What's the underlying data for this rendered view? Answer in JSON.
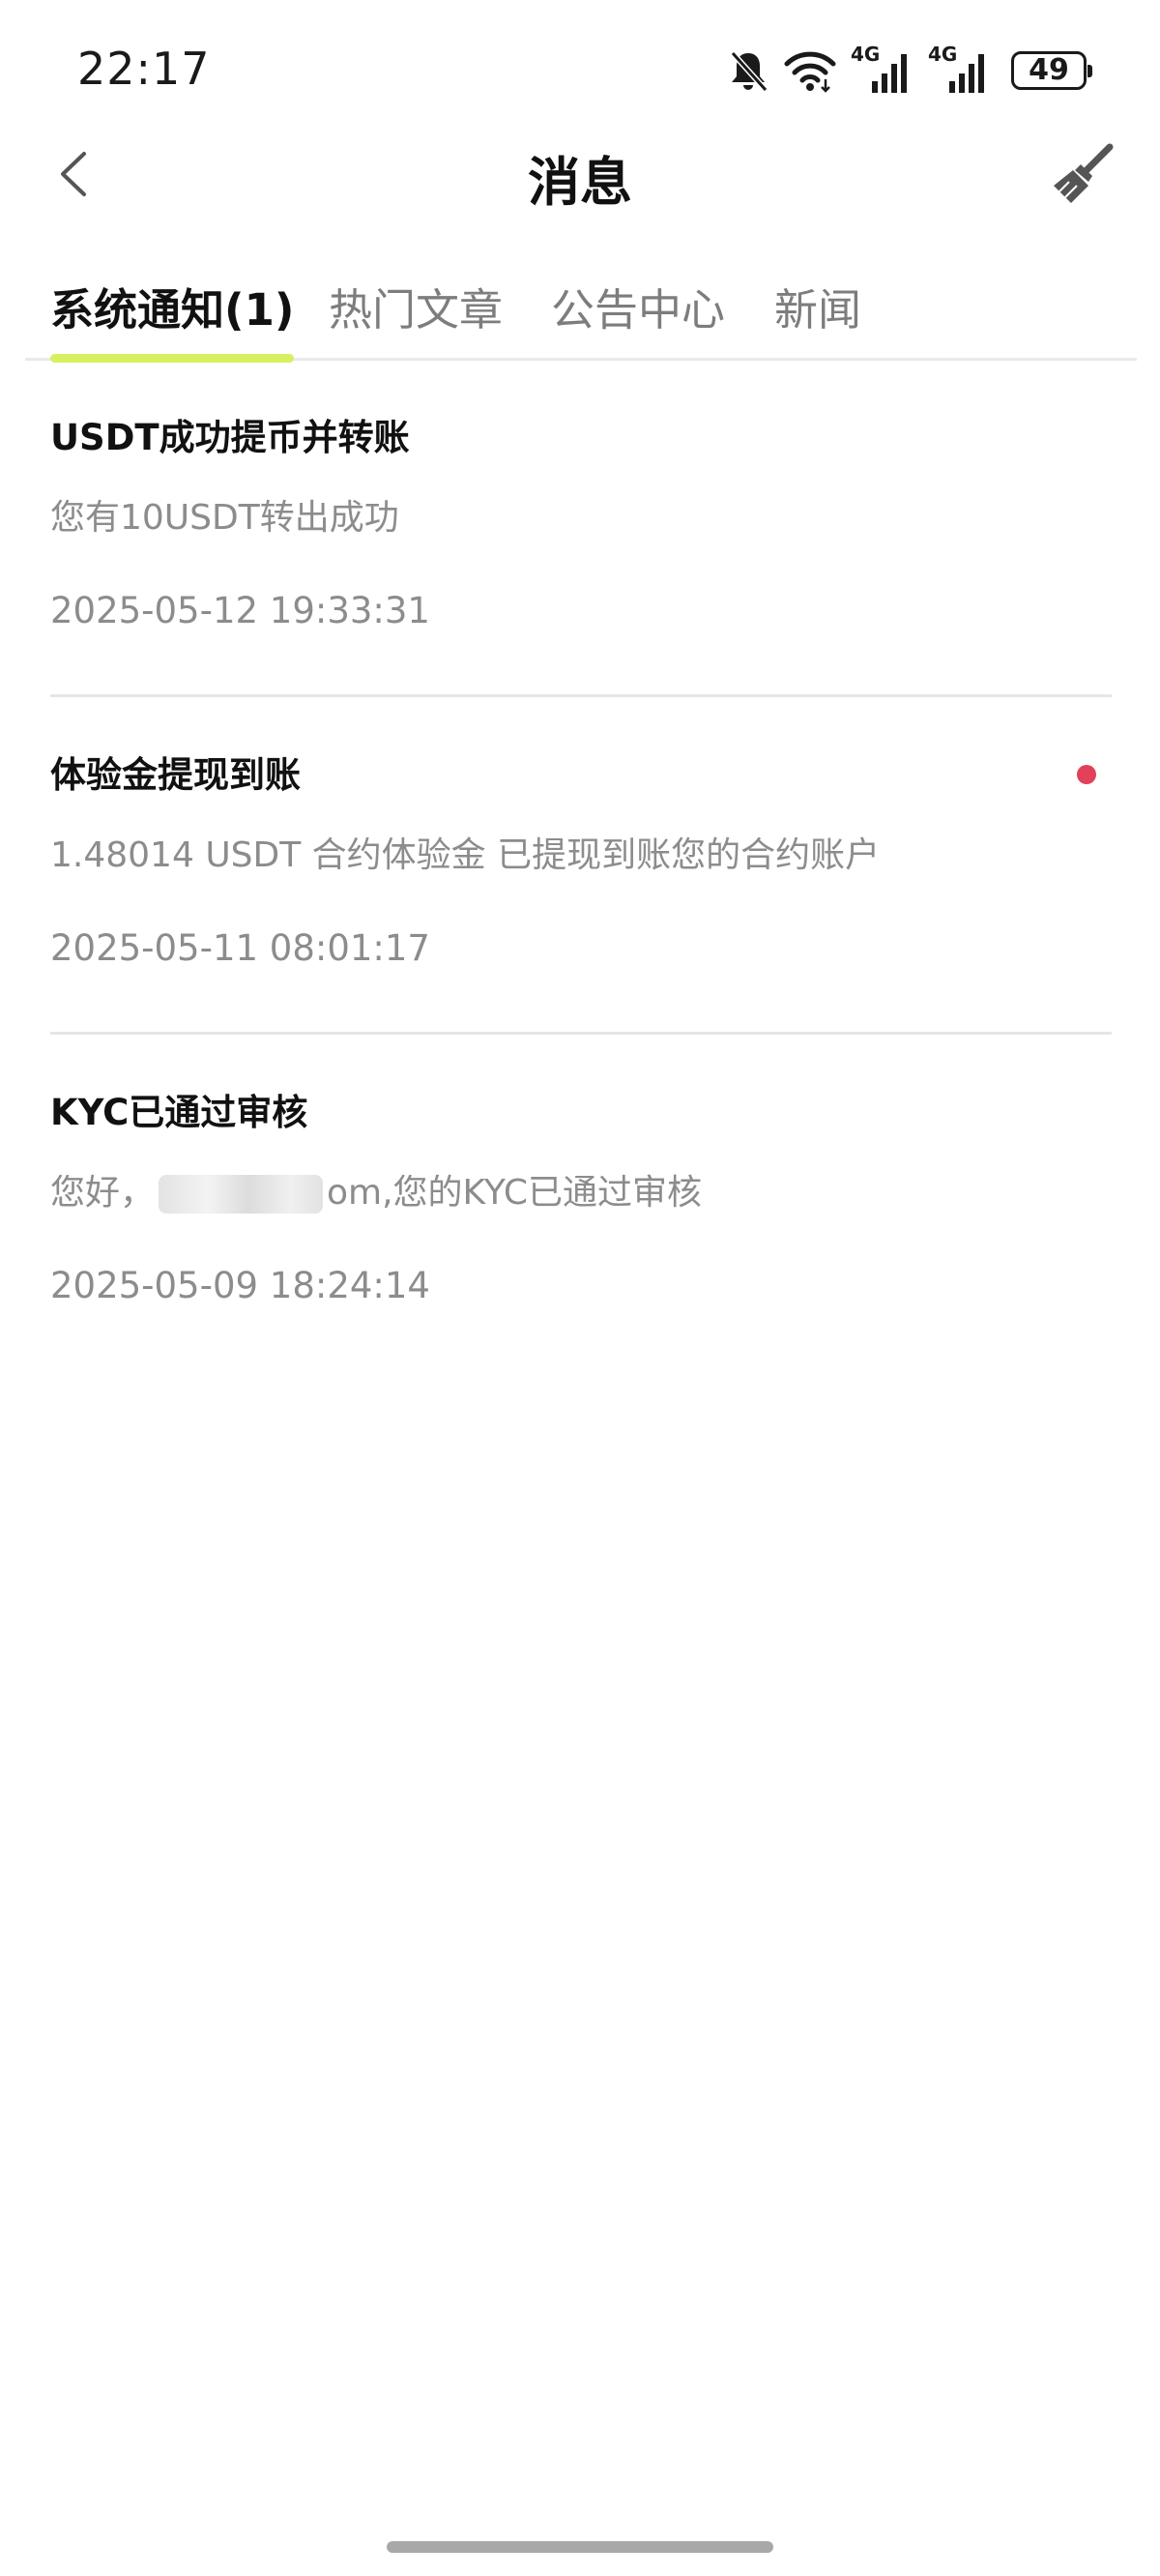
{
  "status_bar": {
    "time": "22:17",
    "network_1": "4G",
    "network_2": "4G",
    "battery": "49",
    "icons": [
      "bell-off-icon",
      "wifi-icon",
      "signal-icon",
      "signal-icon",
      "battery-icon"
    ]
  },
  "header": {
    "title": "消息",
    "back_icon": "chevron-left-icon",
    "clear_icon": "broom-icon"
  },
  "tabs": [
    {
      "label": "系统通知(1)",
      "active": true
    },
    {
      "label": "热门文章",
      "active": false
    },
    {
      "label": "公告中心",
      "active": false
    },
    {
      "label": "新闻",
      "active": false
    }
  ],
  "messages": [
    {
      "title": "USDT成功提币并转账",
      "body": "您有10USDT转出成功",
      "time": "2025-05-12 19:33:31",
      "unread": false
    },
    {
      "title": "体验金提现到账",
      "body": "1.48014 USDT 合约体验金 已提现到账您的合约账户",
      "time": "2025-05-11 08:01:17",
      "unread": true
    },
    {
      "title": "KYC已通过审核",
      "body_prefix": "您好，",
      "body_suffix": "om,您的KYC已通过审核",
      "time": "2025-05-09 18:24:14",
      "unread": false
    }
  ],
  "colors": {
    "tab_underline": "#d6f15f",
    "unread_dot": "#e2415a",
    "secondary_text": "#8c8c8c"
  }
}
